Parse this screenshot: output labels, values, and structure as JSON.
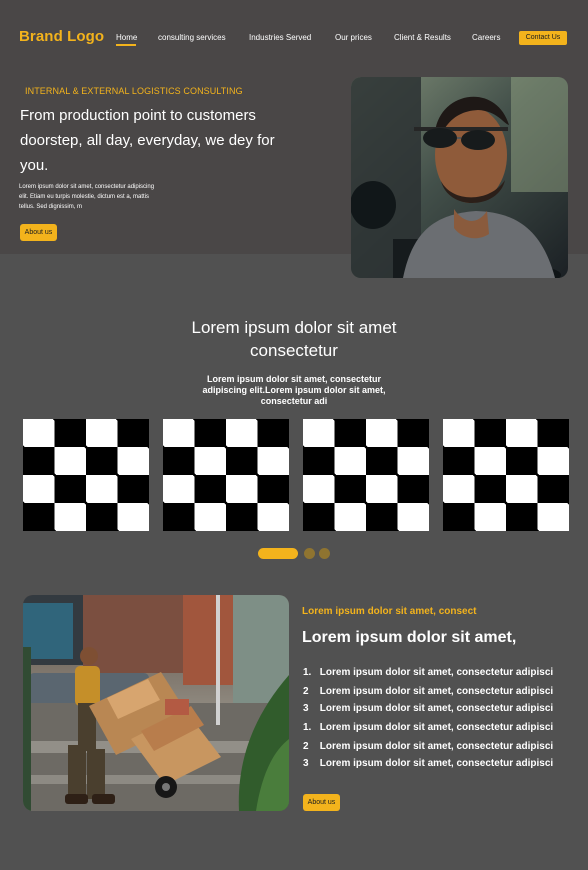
{
  "header": {
    "logo": "Brand Logo",
    "nav": [
      {
        "label": "Home"
      },
      {
        "label": "consulting services"
      },
      {
        "label": "Industries Served"
      },
      {
        "label": "Our prices"
      },
      {
        "label": "Client & Results"
      },
      {
        "label": "Careers"
      }
    ],
    "contact_label": "Contact Us"
  },
  "hero": {
    "eyebrow": "INTERNAL & EXTERNAL LOGISTICS CONSULTING",
    "headline": "From production point to customers doorstep, all day, everyday, we dey for you.",
    "body": "Lorem ipsum dolor sit amet, consectetur adipiscing elit. Etiam eu turpis molestie, dictum est a, mattis tellus. Sed dignissim, m",
    "button_label": "About us"
  },
  "section": {
    "title": "Lorem ipsum dolor sit amet consectetur",
    "subtitle": "Lorem ipsum dolor sit amet, consectetur adipiscing elit.Lorem ipsum dolor sit amet, consectetur adi"
  },
  "carousel": {
    "active_index": 0,
    "count": 3
  },
  "feature": {
    "eyebrow": "Lorem ipsum dolor sit amet, consect",
    "title": "Lorem ipsum dolor sit amet,",
    "items": [
      {
        "marker": "1.",
        "text": "Lorem ipsum dolor sit amet, consectetur adipisci"
      },
      {
        "marker": "2",
        "text": "Lorem ipsum dolor sit amet, consectetur adipisci"
      },
      {
        "marker": "3",
        "text": "Lorem ipsum dolor sit amet, consectetur adipisci"
      },
      {
        "marker": "1.",
        "text": "Lorem ipsum dolor sit amet, consectetur adipisci"
      },
      {
        "marker": "2",
        "text": "Lorem ipsum dolor sit amet, consectetur adipisci"
      },
      {
        "marker": "3",
        "text": "Lorem ipsum dolor sit amet, consectetur adipisci"
      }
    ],
    "button_label": "About us"
  },
  "colors": {
    "accent": "#f3b31c",
    "header_bg": "#4a4747",
    "page_bg": "#515151"
  }
}
